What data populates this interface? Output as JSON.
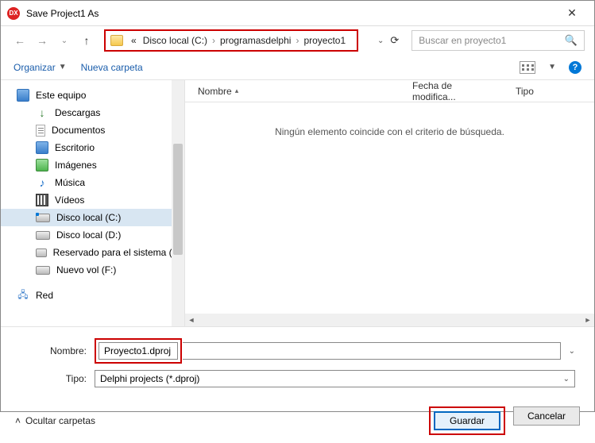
{
  "window": {
    "app_icon_label": "DX",
    "title": "Save Project1 As"
  },
  "breadcrumb": {
    "prefix": "«",
    "segments": [
      "Disco local (C:)",
      "programasdelphi",
      "proyecto1"
    ]
  },
  "search": {
    "placeholder": "Buscar en proyecto1"
  },
  "toolbar": {
    "organize": "Organizar",
    "new_folder": "Nueva carpeta"
  },
  "tree": {
    "root": "Este equipo",
    "items": [
      {
        "label": "Descargas"
      },
      {
        "label": "Documentos"
      },
      {
        "label": "Escritorio"
      },
      {
        "label": "Imágenes"
      },
      {
        "label": "Música"
      },
      {
        "label": "Vídeos"
      },
      {
        "label": "Disco local (C:)"
      },
      {
        "label": "Disco local (D:)"
      },
      {
        "label": "Reservado para el sistema (E:)"
      },
      {
        "label": "Nuevo vol (F:)"
      }
    ],
    "network": "Red"
  },
  "columns": {
    "name": "Nombre",
    "date": "Fecha de modifica...",
    "type": "Tipo"
  },
  "content": {
    "empty_message": "Ningún elemento coincide con el criterio de búsqueda."
  },
  "form": {
    "name_label": "Nombre:",
    "name_value": "Proyecto1.dproj",
    "type_label": "Tipo:",
    "type_value": "Delphi projects (*.dproj)"
  },
  "footer": {
    "collapse": "Ocultar carpetas",
    "save": "Guardar",
    "cancel": "Cancelar"
  }
}
